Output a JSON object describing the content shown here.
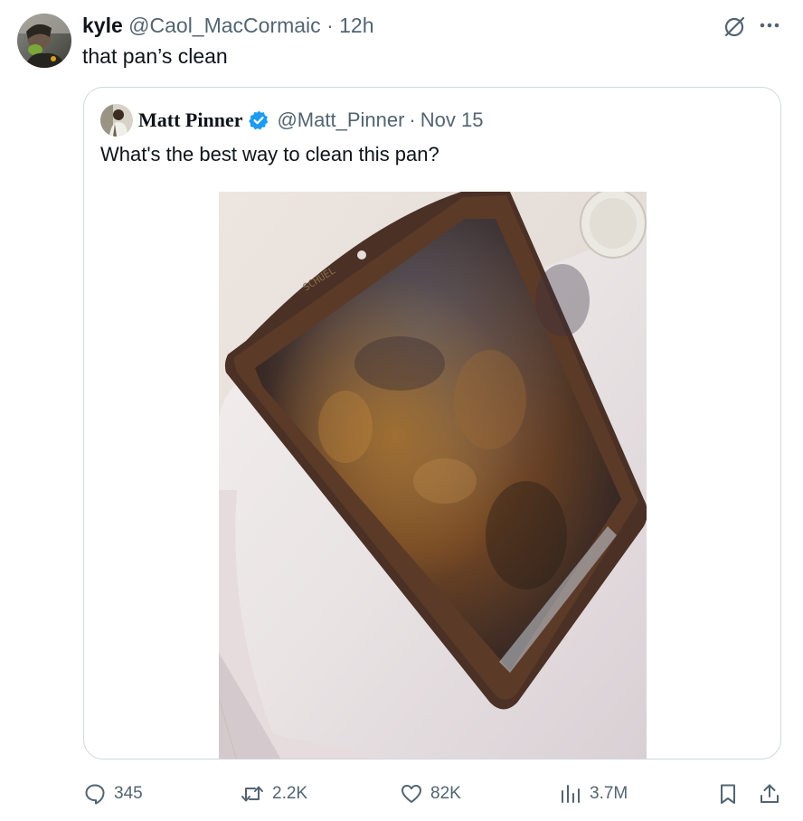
{
  "tweet": {
    "author_name": "kyle",
    "handle": "@Caol_MacCormaic",
    "separator": "·",
    "time": "12h",
    "text": "that pan’s clean"
  },
  "quoted_tweet": {
    "author_name": "Matt Pinner",
    "verified": true,
    "handle": "@Matt_Pinner",
    "separator": "·",
    "date": "Nov 15",
    "text": "What's the best way to clean this pan?",
    "media": {
      "image_text": "SCHUEL"
    }
  },
  "actions": {
    "replies": "345",
    "reposts": "2.2K",
    "likes": "82K",
    "views": "3.7M"
  },
  "icons": {
    "grok": "slashed-circle-icon",
    "more": "more-dots-icon",
    "reply": "speech-bubble-icon",
    "repost": "repost-arrows-icon",
    "like": "heart-icon",
    "views": "bar-chart-icon",
    "bookmark": "bookmark-icon",
    "share": "share-upload-icon",
    "verified": "verified-badge-icon"
  },
  "colors": {
    "text_primary": "#0f1419",
    "text_secondary": "#536471",
    "border": "#cfd9de",
    "verified_blue": "#1d9bf0"
  }
}
